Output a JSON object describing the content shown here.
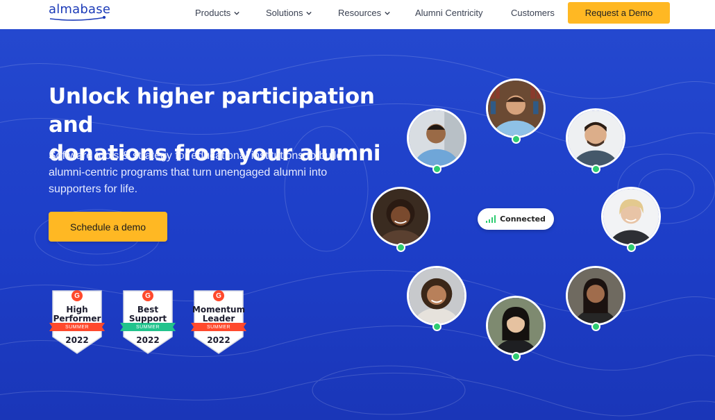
{
  "nav": {
    "logo": "almabase",
    "items": [
      {
        "label": "Products",
        "has_dropdown": true
      },
      {
        "label": "Solutions",
        "has_dropdown": true
      },
      {
        "label": "Resources",
        "has_dropdown": true
      },
      {
        "label": "Alumni Centricity",
        "has_dropdown": false
      },
      {
        "label": "Customers",
        "has_dropdown": false
      }
    ],
    "cta": "Request a Demo"
  },
  "hero": {
    "headline_line1": "Unlock higher participation and",
    "headline_line2": "donations from your alumni",
    "subtitle": "Software tools & strategy for educational institutions to build alumni-centric programs that turn unengaged alumni into supporters for life.",
    "cta": "Schedule a demo"
  },
  "badges": [
    {
      "logo": "G",
      "line1": "High",
      "line2": "Performer",
      "season": "SUMMER",
      "year": "2022",
      "ribbon_color": "#ff492c"
    },
    {
      "logo": "G",
      "line1": "Best",
      "line2": "Support",
      "season": "SUMMER",
      "year": "2022",
      "ribbon_color": "#21c38c"
    },
    {
      "logo": "G",
      "line1": "Momentum",
      "line2": "Leader",
      "season": "SUMMER",
      "year": "2022",
      "ribbon_color": "#ff492c"
    }
  ],
  "network": {
    "status": "Connected",
    "status_icon": "signal-bars-icon"
  },
  "colors": {
    "brand_blue": "#1f3fc9",
    "accent_yellow": "#ffb823",
    "online_green": "#2ecc71"
  }
}
